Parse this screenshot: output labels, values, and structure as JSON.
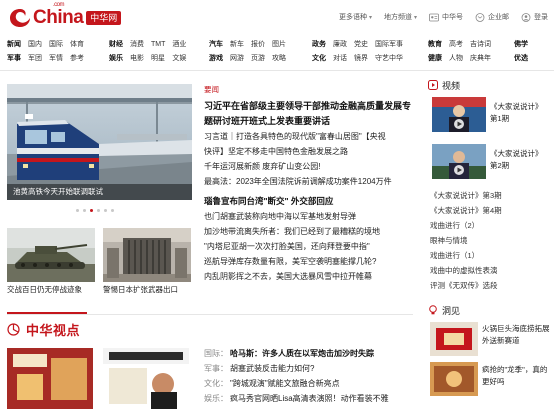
{
  "header": {
    "logo_text": "China",
    "logo_com": ".com",
    "logo_badge": "中华网",
    "links": [
      {
        "label": "更多语种",
        "caret": true
      },
      {
        "label": "地方频道",
        "caret": true
      },
      {
        "label": "中华号",
        "caret": false,
        "icon": "id-card-icon"
      },
      {
        "label": "企业邮",
        "caret": false,
        "icon": "mail-icon"
      },
      {
        "label": "登录",
        "caret": false,
        "icon": "user-icon"
      }
    ]
  },
  "nav": {
    "groups": [
      {
        "row1": [
          "新闻",
          "国内",
          "国际",
          "体育"
        ],
        "row2": [
          "军事",
          "军团",
          "军情",
          "参考"
        ]
      },
      {
        "row1": [
          "财经",
          "消费",
          "TMT",
          "酒业"
        ],
        "row2": [
          "娱乐",
          "电影",
          "明星",
          "文娱"
        ]
      },
      {
        "row1": [
          "汽车",
          "新车",
          "报价",
          "图片"
        ],
        "row2": [
          "游戏",
          "网游",
          "页游",
          "攻略"
        ]
      },
      {
        "row1": [
          "政务",
          "廉政",
          "党史",
          "国际军事"
        ],
        "row2": [
          "文化",
          "对话",
          "镜界",
          "守艺中华"
        ]
      },
      {
        "row1": [
          "教育",
          "高考",
          "吉诗词"
        ],
        "row2": [
          "健康",
          "人物",
          "庆典年"
        ]
      },
      {
        "row1": [
          "佛学"
        ],
        "row2": [
          "优选"
        ]
      }
    ]
  },
  "hero": {
    "caption": "池黄高铁今天开始联调联试",
    "slide_count": 6,
    "active_slide": 2
  },
  "thumbs": [
    {
      "caption": "交战百日仍无停战迹象"
    },
    {
      "caption": "警惕日本扩张武器出口"
    }
  ],
  "news": {
    "section_label": "要闻",
    "lead": "习近平在省部级主要领导干部推动金融高质量发展专题研讨班开班式上发表重要讲话",
    "items1": [
      "习言道｜打造各具特色的现代版\"富春山居图\"【央视",
      "快评】坚定不移走中国特色金融发展之路",
      "千年运河展新颜 废弃矿山变公园!",
      "最高法：2023年全国法院诉前调解成功案件1204万件"
    ],
    "bold_item": "瑙鲁宣布同台湾\"断交\" 外交部回应",
    "items2": [
      "也门胡塞武装称向地中海以军基地发射导弹",
      "加沙地带流离失所者：我们已经到了最糟糕的境地",
      "\"内塔尼亚胡一次次打脸美国，还向拜登要中指\"",
      "巡航导弹库存数量有限，美军空袭明塞能撑几轮?",
      "内乱阴影挥之不去，美国大选暴风雪中拉开帷幕"
    ]
  },
  "video": {
    "heading": "视频",
    "items": [
      {
        "title": "《大家说说计》",
        "sub": "第1期"
      },
      {
        "title": "《大家说说计》",
        "sub": "第2期"
      }
    ],
    "list": [
      "《大家说说计》第3期",
      "《大家说说计》第4期",
      "戏曲进行（2）",
      "眼神与情境",
      "戏曲进行（1）",
      "戏曲中的虚拟性表演",
      "评测《无双传》选段"
    ]
  },
  "viewpoint": {
    "title": "中华视点",
    "items": [
      {
        "tag": "国际：",
        "text": "哈马斯：许多人质在以军炮击加沙时失踪",
        "bold": true
      },
      {
        "tag": "军事：",
        "text": "胡塞武装反击能力如何?",
        "bold": false
      },
      {
        "tag": "文化：",
        "text": "\"跨城观演\"赋能文旅融合新亮点",
        "bold": false
      },
      {
        "tag": "娱乐：",
        "text": "疯马秀官网晒Lisa高清表演照！动作看装不雅",
        "bold": false
      }
    ]
  },
  "opinion": {
    "heading": "洞见",
    "items": [
      {
        "text": "火锅巨头海底捞拓展外送新赛道"
      },
      {
        "text": "疯抢的\"龙季\"，真的更好吗"
      }
    ]
  },
  "colors": {
    "brand": "#c4161c",
    "nav_text": "#333333"
  }
}
